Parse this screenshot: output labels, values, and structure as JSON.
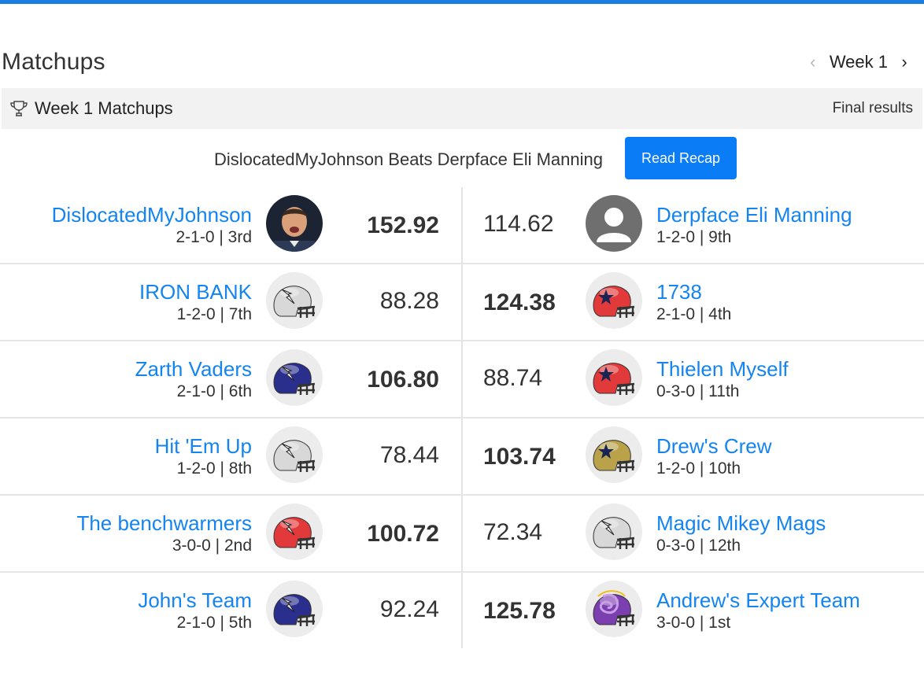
{
  "page": {
    "title": "Matchups"
  },
  "week_nav": {
    "prev_icon": "chevron-left-icon",
    "label": "Week 1",
    "next_icon": "chevron-right-icon"
  },
  "section": {
    "icon": "trophy-icon",
    "title": "Week 1 Matchups",
    "status": "Final results"
  },
  "recap": {
    "text": "DislocatedMyJohnson Beats Derpface Eli Manning",
    "button_label": "Read Recap"
  },
  "colors": {
    "accent": "#1a7fe0",
    "link": "#1484f0",
    "button": "#0a7cf5"
  },
  "matchups": [
    {
      "home": {
        "name": "DislocatedMyJohnson",
        "record": "2-1-0 | 3rd",
        "score": "152.92",
        "winner": true,
        "avatar": "player-photo",
        "helmet_color": ""
      },
      "away": {
        "name": "Derpface Eli Manning",
        "record": "1-2-0 | 9th",
        "score": "114.62",
        "winner": false,
        "avatar": "default-user-icon",
        "helmet_color": ""
      }
    },
    {
      "home": {
        "name": "IRON BANK",
        "record": "1-2-0 | 7th",
        "score": "88.28",
        "winner": false,
        "avatar": "helmet-icon",
        "helmet_color": "#d8d8d8"
      },
      "away": {
        "name": "1738",
        "record": "2-1-0 | 4th",
        "score": "124.38",
        "winner": true,
        "avatar": "helmet-star-icon",
        "helmet_color": "#e23a3a"
      }
    },
    {
      "home": {
        "name": "Zarth Vaders",
        "record": "2-1-0 | 6th",
        "score": "106.80",
        "winner": true,
        "avatar": "helmet-icon",
        "helmet_color": "#2a2f8e"
      },
      "away": {
        "name": "Thielen Myself",
        "record": "0-3-0 | 11th",
        "score": "88.74",
        "winner": false,
        "avatar": "helmet-star-icon",
        "helmet_color": "#e23a3a"
      }
    },
    {
      "home": {
        "name": "Hit 'Em Up",
        "record": "1-2-0 | 8th",
        "score": "78.44",
        "winner": false,
        "avatar": "helmet-icon",
        "helmet_color": "#d8d8d8"
      },
      "away": {
        "name": "Drew's Crew",
        "record": "1-2-0 | 10th",
        "score": "103.74",
        "winner": true,
        "avatar": "helmet-star-icon",
        "helmet_color": "#b9a24a"
      }
    },
    {
      "home": {
        "name": "The benchwarmers",
        "record": "3-0-0 | 2nd",
        "score": "100.72",
        "winner": true,
        "avatar": "helmet-icon",
        "helmet_color": "#e23a3a"
      },
      "away": {
        "name": "Magic Mikey Mags",
        "record": "0-3-0 | 12th",
        "score": "72.34",
        "winner": false,
        "avatar": "helmet-icon",
        "helmet_color": "#d8d8d8"
      }
    },
    {
      "home": {
        "name": "John's Team",
        "record": "2-1-0 | 5th",
        "score": "92.24",
        "winner": false,
        "avatar": "helmet-icon",
        "helmet_color": "#2a2f8e"
      },
      "away": {
        "name": "Andrew's Expert Team",
        "record": "3-0-0 | 1st",
        "score": "125.78",
        "winner": true,
        "avatar": "helmet-swirl-icon",
        "helmet_color": "#7b3fb0"
      }
    }
  ]
}
